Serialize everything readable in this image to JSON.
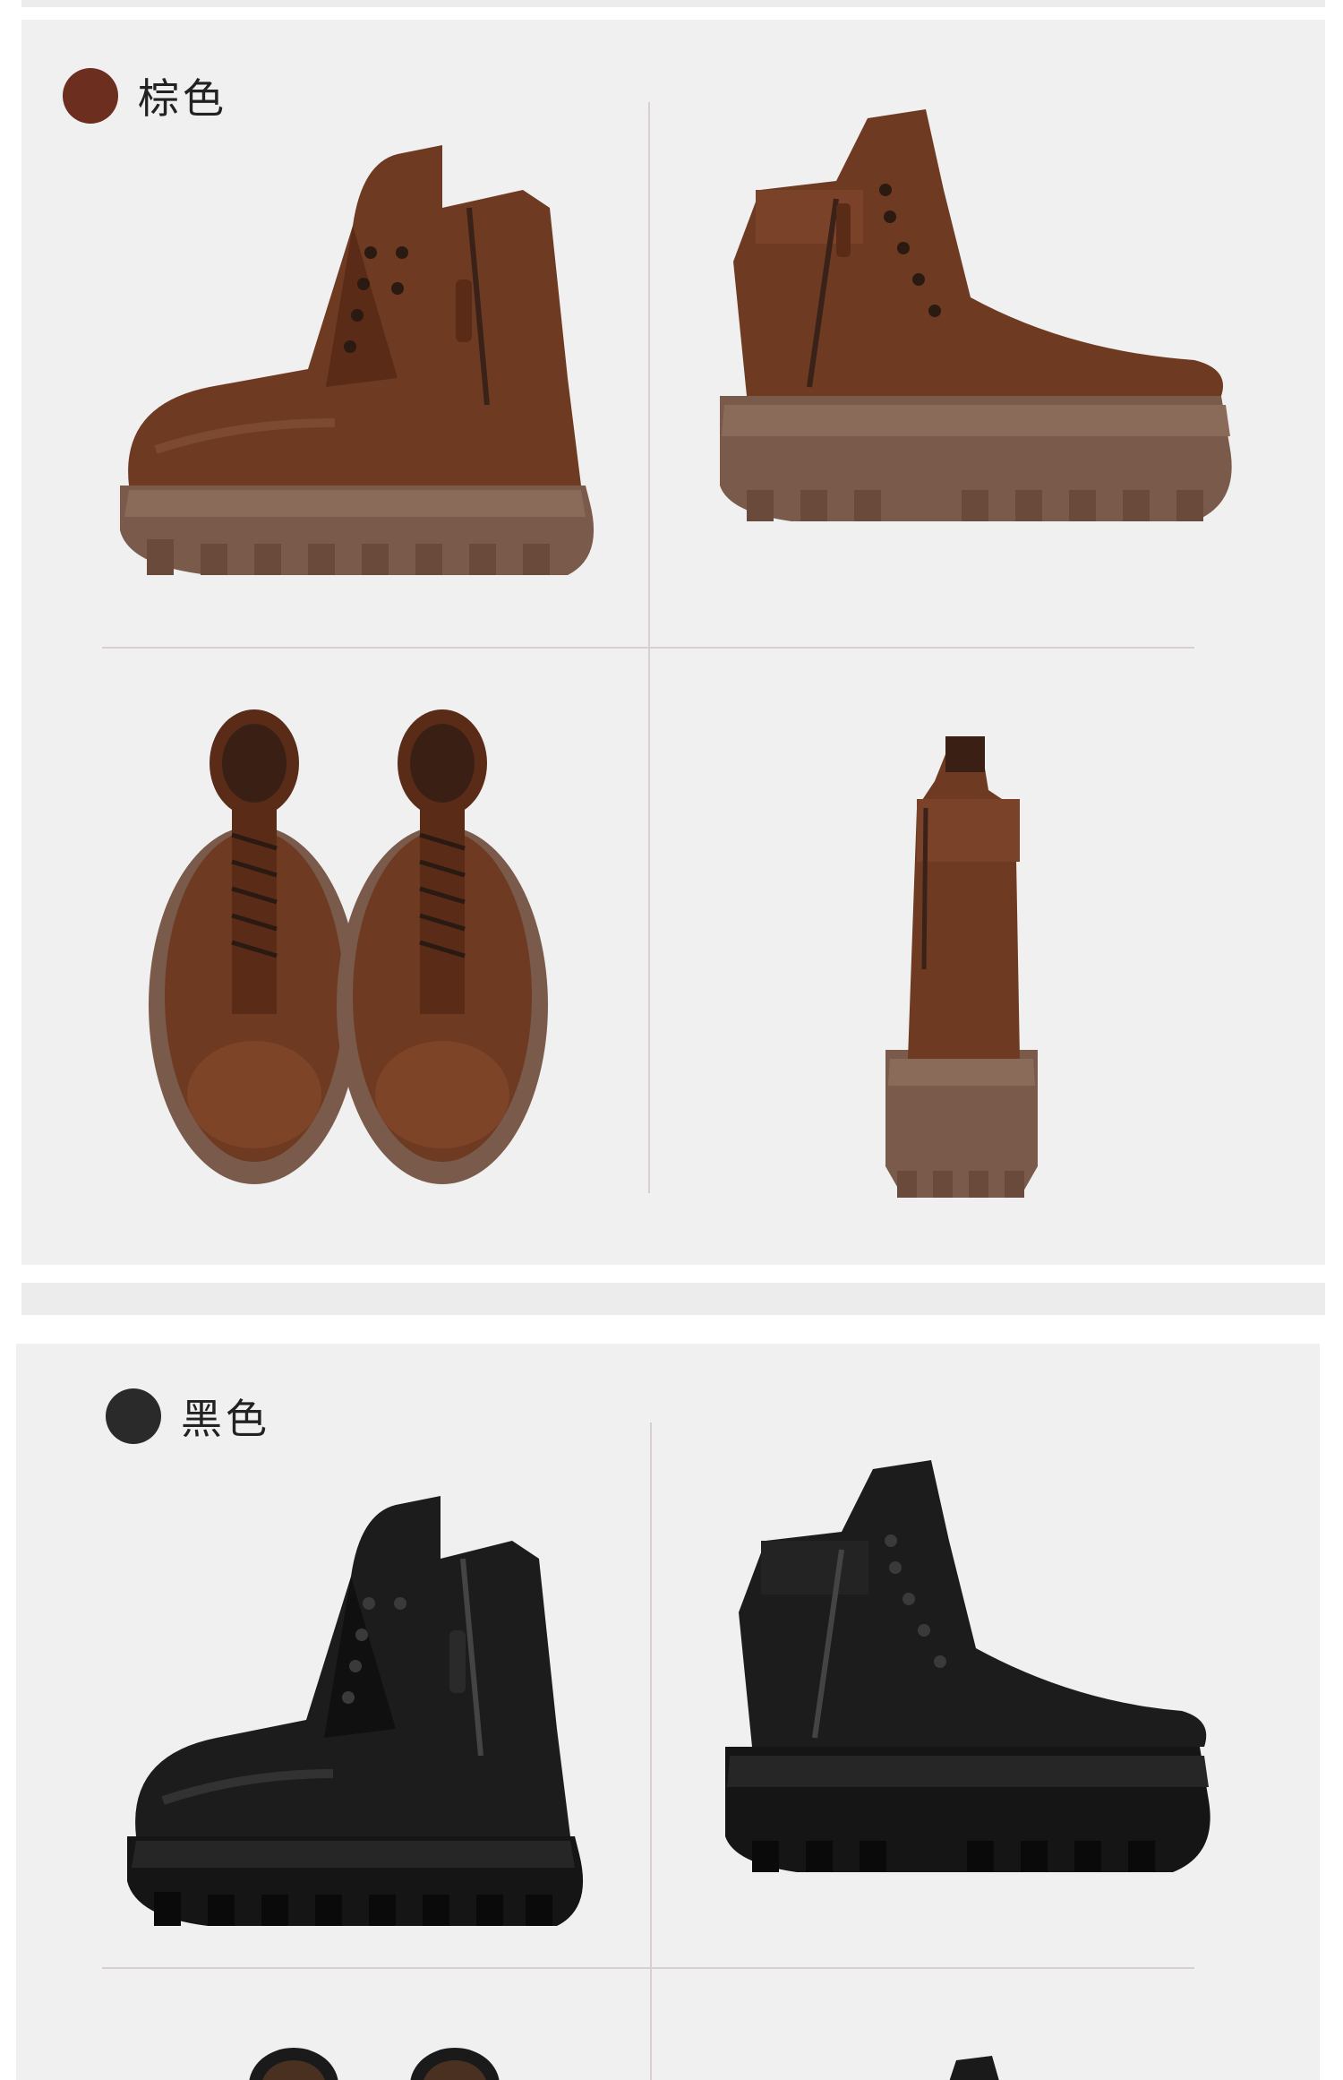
{
  "colors": {
    "page_bg": "#ffffff",
    "panel_bg": "#f0f0f0",
    "brown_swatch": "#6b2e1f",
    "black_swatch": "#2a2a2a",
    "brown_leather": "#6e3a22",
    "brown_sole": "#7a5a4a",
    "black_leather": "#1c1c1c",
    "black_sole": "#151515"
  },
  "sections": [
    {
      "label": "棕色",
      "views": [
        "side-outer-view",
        "side-inner-view",
        "top-pair-view",
        "back-view"
      ]
    },
    {
      "label": "黑色",
      "views": [
        "side-outer-view",
        "side-inner-view",
        "top-pair-view",
        "back-view"
      ]
    }
  ]
}
